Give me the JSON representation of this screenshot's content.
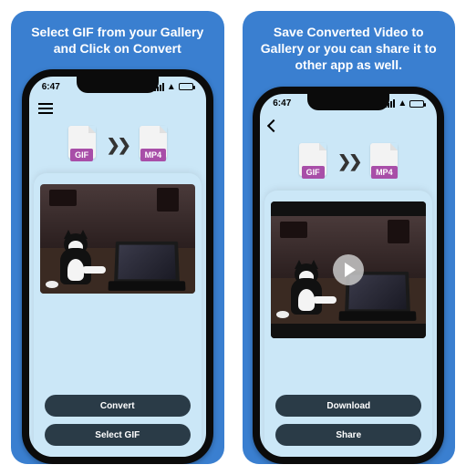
{
  "panels": [
    {
      "title": "Select GIF from your Gallery and Click on Convert",
      "time": "6:47",
      "file_from": "GIF",
      "file_to": "MP4",
      "buttons": {
        "primary": "Convert",
        "secondary": "Select GIF"
      },
      "nav": "menu"
    },
    {
      "title": "Save Converted Video to Gallery or you can share it to other app as well.",
      "time": "6:47",
      "file_from": "GIF",
      "file_to": "MP4",
      "buttons": {
        "primary": "Download",
        "secondary": "Share"
      },
      "nav": "back"
    }
  ]
}
